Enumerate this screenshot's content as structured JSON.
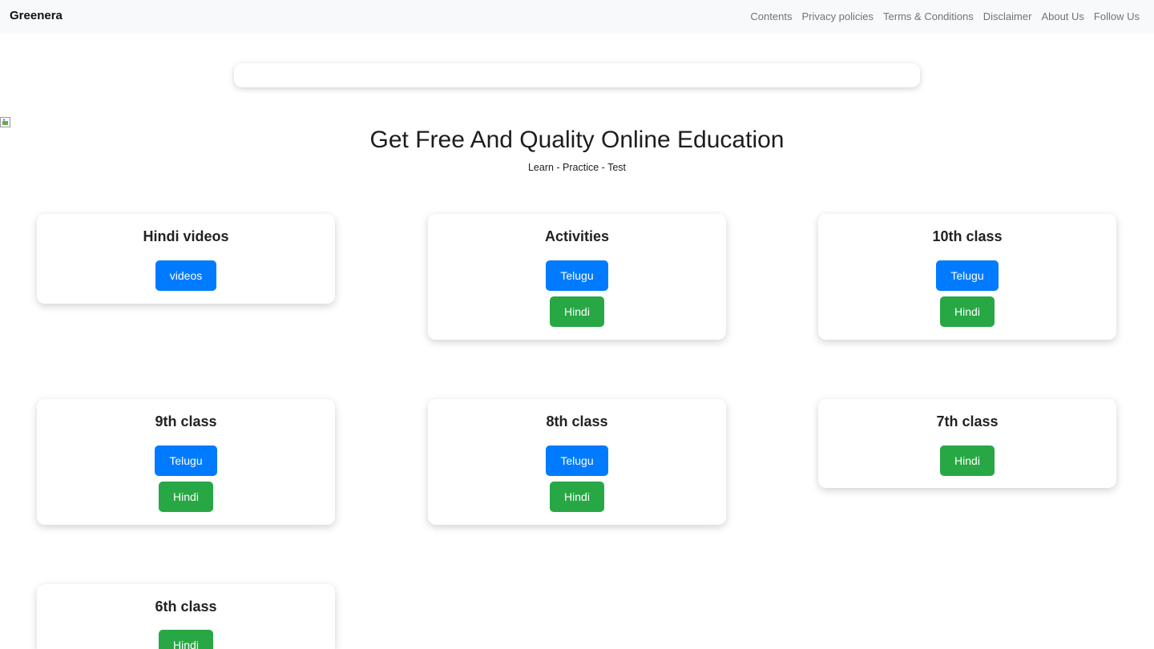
{
  "navbar": {
    "brand": "Greenera",
    "links": [
      "Contents",
      "Privacy policies",
      "Terms & Conditions",
      "Disclaimer",
      "About Us",
      "Follow Us"
    ]
  },
  "hero": {
    "title": "Get Free And Quality Online Education",
    "subtitle": "Learn - Practice - Test"
  },
  "cards": [
    {
      "title": "Hindi videos",
      "buttons": [
        {
          "label": "videos",
          "color": "#007bff"
        }
      ]
    },
    {
      "title": "Activities",
      "buttons": [
        {
          "label": "Telugu",
          "color": "#007bff"
        },
        {
          "label": "Hindi",
          "color": "#28a745"
        }
      ]
    },
    {
      "title": "10th class",
      "buttons": [
        {
          "label": "Telugu",
          "color": "#007bff"
        },
        {
          "label": "Hindi",
          "color": "#28a745"
        }
      ]
    },
    {
      "title": "9th class",
      "buttons": [
        {
          "label": "Telugu",
          "color": "#007bff"
        },
        {
          "label": "Hindi",
          "color": "#28a745"
        }
      ]
    },
    {
      "title": "8th class",
      "buttons": [
        {
          "label": "Telugu",
          "color": "#007bff"
        },
        {
          "label": "Hindi",
          "color": "#28a745"
        }
      ]
    },
    {
      "title": "7th class",
      "buttons": [
        {
          "label": "Hindi",
          "color": "#28a745"
        }
      ]
    },
    {
      "title": "6th class",
      "buttons": [
        {
          "label": "Hindi",
          "color": "#28a745"
        }
      ]
    }
  ]
}
